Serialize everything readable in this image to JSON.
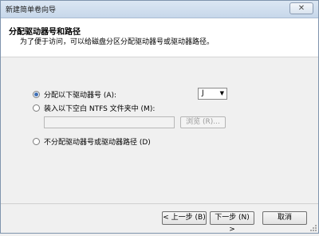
{
  "window": {
    "title": "新建简单卷向导",
    "close_symbol": "✕"
  },
  "header": {
    "title": "分配驱动器号和路径",
    "subtitle": "为了便于访问，可以给磁盘分区分配驱动器号或驱动器路径。"
  },
  "options": {
    "assign_letter": {
      "label": "分配以下驱动器号 (A):",
      "selected": true
    },
    "mount_folder": {
      "label": "装入以下空白 NTFS 文件夹中 (M):",
      "selected": false
    },
    "no_assign": {
      "label": "不分配驱动器号或驱动器路径 (D)",
      "selected": false
    }
  },
  "drive_letter": {
    "value": "J",
    "arrow": "▼"
  },
  "folder_path": {
    "value": "",
    "browse_label": "浏览 (R)..."
  },
  "buttons": {
    "back": "< 上一步 (B)",
    "next": "下一步 (N) >",
    "cancel": "取消"
  }
}
